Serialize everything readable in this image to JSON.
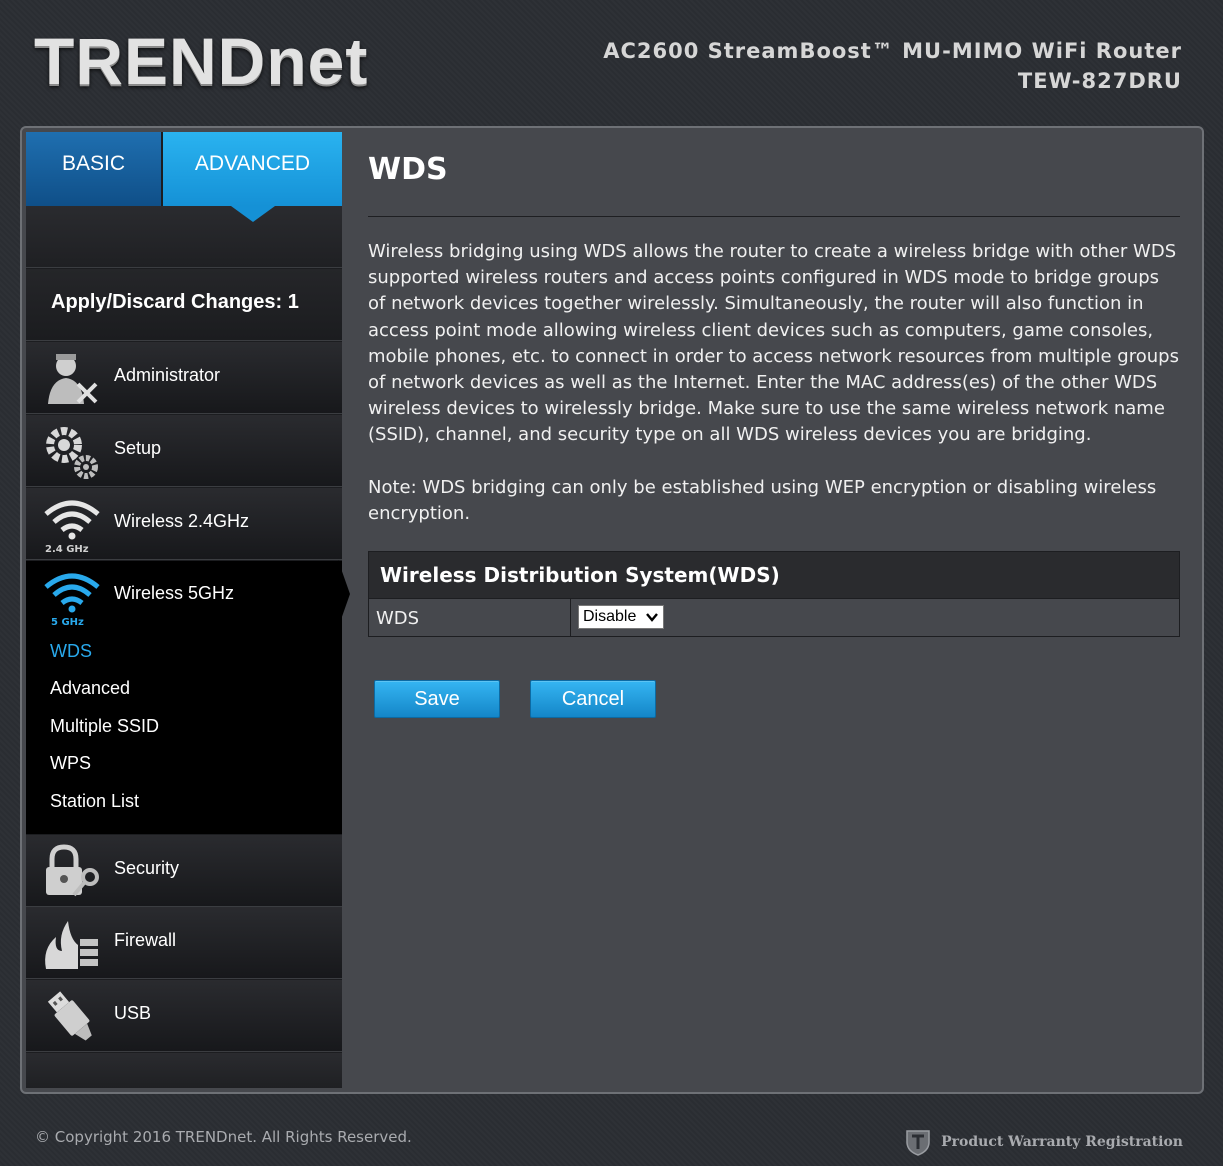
{
  "brand": {
    "logo_text": "TRENDnet"
  },
  "header": {
    "product_line": "AC2600 StreamBoost™ MU-MIMO WiFi Router",
    "model": "TEW-827DRU"
  },
  "tabs": [
    {
      "label": "BASIC",
      "active": false
    },
    {
      "label": "ADVANCED",
      "active": true
    }
  ],
  "sidebar": {
    "apply_label": "Apply/Discard Changes: 1",
    "items": [
      {
        "label": "Administrator",
        "icon": "administrator-icon"
      },
      {
        "label": "Setup",
        "icon": "gear-icon"
      },
      {
        "label": "Wireless 2.4GHz",
        "icon": "wifi-2-4ghz-icon",
        "badge": "2.4 GHz"
      },
      {
        "label": "Wireless 5GHz",
        "icon": "wifi-5ghz-icon",
        "badge": "5 GHz",
        "active": true
      },
      {
        "label": "Security",
        "icon": "lock-key-icon"
      },
      {
        "label": "Firewall",
        "icon": "firewall-icon"
      },
      {
        "label": "USB",
        "icon": "usb-icon"
      }
    ],
    "subitems": [
      {
        "label": "WDS",
        "active": true
      },
      {
        "label": "Advanced"
      },
      {
        "label": "Multiple SSID"
      },
      {
        "label": "WPS"
      },
      {
        "label": "Station List"
      }
    ]
  },
  "content": {
    "title": "WDS",
    "description": "Wireless bridging using WDS allows the router to create a wireless bridge with other WDS supported wireless routers and access points configured in WDS mode to bridge groups of network devices together wirelessly. Simultaneously, the router will also function in access point mode allowing wireless client devices such as computers, game consoles, mobile phones, etc. to connect in order to access network resources from multiple groups of network devices as well as the Internet. Enter the MAC address(es) of the other WDS wireless devices to wirelessly bridge. Make sure to use the same wireless network name (SSID), channel, and security type on all WDS wireless devices you are bridging.",
    "note": "Note: WDS bridging can only be established using WEP encryption or disabling wireless encryption.",
    "table": {
      "heading": "Wireless Distribution System(WDS)",
      "row_label": "WDS",
      "select_value": "Disable"
    },
    "save_label": "Save",
    "cancel_label": "Cancel"
  },
  "footer": {
    "copyright": "© Copyright 2016 TRENDnet. All Rights Reserved.",
    "warranty": "Product Warranty Registration"
  },
  "colors": {
    "accent_blue": "#1591d6",
    "active_link": "#29a9ec",
    "panel_bg": "#46484d"
  }
}
